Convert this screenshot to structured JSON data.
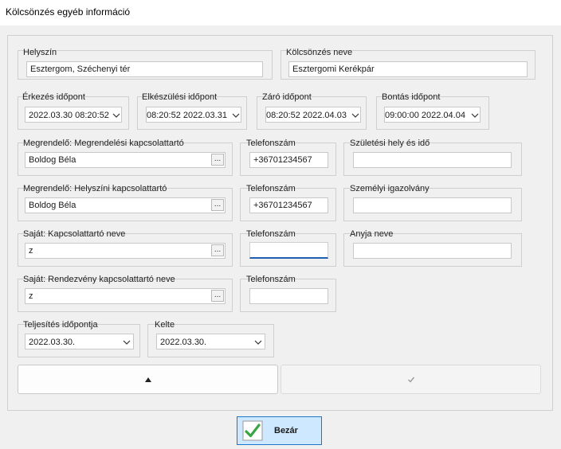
{
  "window": {
    "title": "Kölcsönzés egyéb információ"
  },
  "colors": {
    "accent": "#1e76c8",
    "focus_underline": "#1f5fb0",
    "check_green": "#3aa541"
  },
  "location": {
    "label": "Helyszín",
    "value": "Esztergom, Széchenyi tér"
  },
  "rental_name": {
    "label": "Kölcsönzés neve",
    "value": "Esztergomi Kerékpár"
  },
  "times": {
    "arrival": {
      "label": "Érkezés időpont",
      "value": "2022.03.30 08:20:52"
    },
    "ready": {
      "label": "Elkészülési időpont",
      "value": "2022.03.31 08:20:52"
    },
    "closing": {
      "label": "Záró időpont",
      "value": "2022.04.03 08:20:52"
    },
    "teardown": {
      "label": "Bontás időpont",
      "value": "2022.04.04 09:00:00"
    }
  },
  "contacts": {
    "order_contact": {
      "label": "Megrendelő: Megrendelési kapcsolattartó",
      "value": "Boldog Béla",
      "phone_label": "Telefonszám",
      "phone": "+36701234567"
    },
    "onsite_contact": {
      "label": "Megrendelő: Helyszíni kapcsolattartó",
      "value": "Boldog Béla",
      "phone_label": "Telefonszám",
      "phone": "+36701234567"
    },
    "own_contact": {
      "label": "Saját: Kapcsolattartó neve",
      "value": "z",
      "phone_label": "Telefonszám",
      "phone": ""
    },
    "event_contact": {
      "label": "Saját: Rendezvény kapcsolattartó neve",
      "value": "z",
      "phone_label": "Telefonszám",
      "phone": ""
    },
    "lookup_label": "..."
  },
  "personal": {
    "birth": {
      "label": "Születési hely és idő",
      "value": ""
    },
    "id_card": {
      "label": "Személyi igazolvány",
      "value": ""
    },
    "mother_name": {
      "label": "Anyja neve",
      "value": ""
    }
  },
  "dates": {
    "fulfillment": {
      "label": "Teljesítés időpontja",
      "value": "2022.03.30."
    },
    "issued": {
      "label": "Kelte",
      "value": "2022.03.30."
    }
  },
  "buttons": {
    "close_label": "Bezár"
  },
  "icons": {
    "up": "triangle-up-icon",
    "check": "check-icon",
    "close": "green-check-icon",
    "dropdown": "chevron-down-icon"
  }
}
